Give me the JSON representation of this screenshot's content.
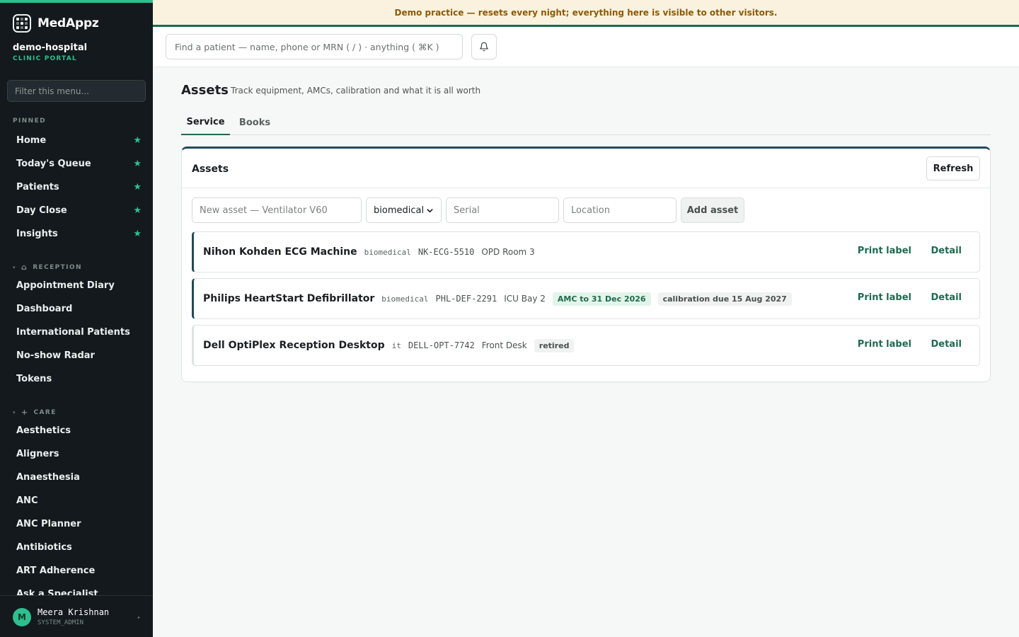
{
  "brand": {
    "name": "MedAppz"
  },
  "org": {
    "name": "demo-hospital",
    "subtitle": "CLINIC PORTAL"
  },
  "sidebar": {
    "filter_placeholder": "Filter this menu...",
    "pinned_label": "PINNED",
    "pinned": [
      {
        "label": "Home"
      },
      {
        "label": "Today's Queue"
      },
      {
        "label": "Patients"
      },
      {
        "label": "Day Close"
      },
      {
        "label": "Insights"
      }
    ],
    "reception_label": "RECEPTION",
    "reception": [
      {
        "label": "Appointment Diary"
      },
      {
        "label": "Dashboard"
      },
      {
        "label": "International Patients"
      },
      {
        "label": "No-show Radar"
      },
      {
        "label": "Tokens"
      }
    ],
    "care_label": "CARE",
    "care": [
      {
        "label": "Aesthetics"
      },
      {
        "label": "Aligners"
      },
      {
        "label": "Anaesthesia"
      },
      {
        "label": "ANC"
      },
      {
        "label": "ANC Planner"
      },
      {
        "label": "Antibiotics"
      },
      {
        "label": "ART Adherence"
      },
      {
        "label": "Ask a Specialist"
      }
    ]
  },
  "user": {
    "initial": "M",
    "name": "Meera Krishnan",
    "role": "SYSTEM_ADMIN"
  },
  "banner": {
    "text": "Demo practice — resets every night; everything here is visible to other visitors."
  },
  "topbar": {
    "search_placeholder": "Find a patient — name, phone or MRN ( / ) · anything ( ⌘K )"
  },
  "page": {
    "title": "Assets",
    "subtitle": "Track equipment, AMCs, calibration and what it is all worth",
    "tabs": [
      {
        "label": "Service"
      },
      {
        "label": "Books"
      }
    ]
  },
  "card": {
    "title": "Assets",
    "refresh_label": "Refresh",
    "form": {
      "name_placeholder": "New asset — Ventilator V60",
      "category_value": "biomedical",
      "serial_placeholder": "Serial",
      "location_placeholder": "Location",
      "add_label": "Add asset"
    },
    "assets": [
      {
        "name": "Nihon Kohden ECG Machine",
        "category": "biomedical",
        "serial": "NK-ECG-5510",
        "location": "OPD Room 3"
      },
      {
        "name": "Philips HeartStart Defibrillator",
        "category": "biomedical",
        "serial": "PHL-DEF-2291",
        "location": "ICU Bay 2",
        "amc": "AMC to 31 Dec 2026",
        "calibration": "calibration due 15 Aug 2027"
      },
      {
        "name": "Dell OptiPlex Reception Desktop",
        "category": "it",
        "serial": "DELL-OPT-7742",
        "location": "Front Desk",
        "status": "retired"
      }
    ],
    "print_label": "Print label",
    "detail_label": "Detail"
  }
}
